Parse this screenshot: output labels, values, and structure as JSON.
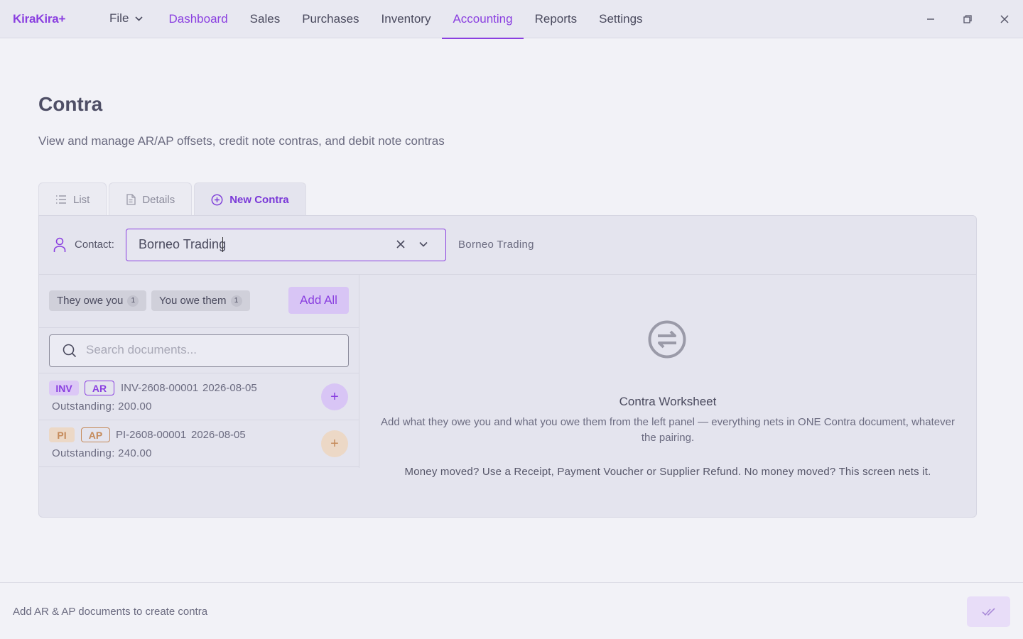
{
  "app": {
    "logo": "KiraKira+",
    "file_menu": "File",
    "nav": [
      {
        "label": "Dashboard"
      },
      {
        "label": "Sales"
      },
      {
        "label": "Purchases"
      },
      {
        "label": "Inventory"
      },
      {
        "label": "Accounting"
      },
      {
        "label": "Reports"
      },
      {
        "label": "Settings"
      }
    ],
    "active_nav": "Accounting",
    "accent_color": "#8a3fe0"
  },
  "header": {
    "title": "Contra",
    "subtitle": "View and manage AR/AP offsets, credit note contras, and debit note contras"
  },
  "tabs": [
    {
      "label": "List",
      "icon": "list-icon"
    },
    {
      "label": "Details",
      "icon": "document-icon"
    },
    {
      "label": "New Contra",
      "icon": "plus-circle-icon",
      "active": true
    }
  ],
  "contact": {
    "label": "Contact:",
    "value": "Borneo Trading",
    "selected_name": "Borneo Trading"
  },
  "filters": {
    "they_owe_you": {
      "label": "They owe you",
      "count": "1"
    },
    "you_owe_them": {
      "label": "You owe them",
      "count": "1"
    },
    "add_all": "Add All"
  },
  "search": {
    "placeholder": "Search documents..."
  },
  "documents": [
    {
      "type": "INV",
      "side": "AR",
      "number": "INV-2608-00001",
      "date": "2026-08-05",
      "outstanding": "Outstanding: 200.00"
    },
    {
      "type": "PI",
      "side": "AP",
      "number": "PI-2608-00001",
      "date": "2026-08-05",
      "outstanding": "Outstanding: 240.00"
    }
  ],
  "worksheet": {
    "title": "Contra Worksheet",
    "description": "Add what they owe you and what you owe them from the left panel — everything nets in ONE Contra document, whatever the pairing.",
    "note": "Money moved? Use a Receipt, Payment Voucher or Supplier Refund. No money moved? This screen nets it."
  },
  "footer": {
    "status": "Add AR & AP documents to create contra"
  }
}
